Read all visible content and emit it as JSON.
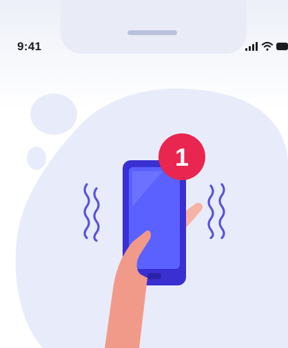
{
  "status_bar": {
    "time": "9:41",
    "icons": [
      "signal-icon",
      "wifi-icon",
      "battery-icon"
    ]
  },
  "illustration": {
    "notification_badge": {
      "count": "1",
      "color": "#e8264f"
    },
    "phone_color": "#3a2fd0",
    "screen_color": "#5a61ff",
    "blob_color": "#e8ecfa",
    "vibration_color": "#5a50e0",
    "hand_color": "#f29a89"
  }
}
